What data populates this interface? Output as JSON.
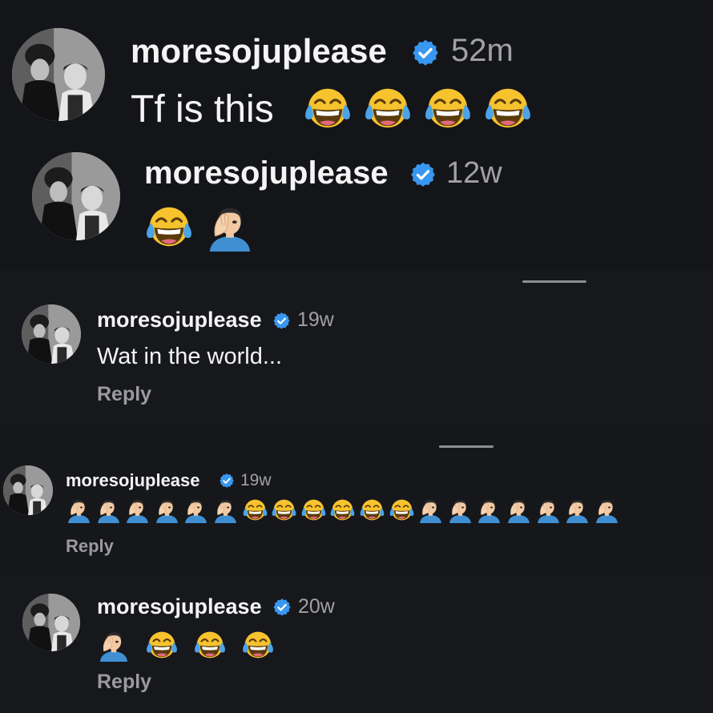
{
  "colors": {
    "background": "#141519",
    "verified_badge": "#3897f0",
    "username": "#f4f4f4",
    "timestamp": "#a0a0a6",
    "reply": "#9a9aa0"
  },
  "comments": [
    {
      "username": "moresojuplease",
      "verified": true,
      "time": "52m",
      "text": "Tf is this",
      "emojis": [
        "joy",
        "joy",
        "joy",
        "joy"
      ],
      "reply_label": ""
    },
    {
      "username": "moresojuplease",
      "verified": true,
      "time": "12w",
      "text": "",
      "emojis": [
        "joy",
        "facepalm"
      ],
      "reply_label": ""
    },
    {
      "username": "moresojuplease",
      "verified": true,
      "time": "19w",
      "text": "Wat in the world...",
      "emojis": [],
      "reply_label": "Reply"
    },
    {
      "username": "moresojuplease",
      "verified": true,
      "time": "19w",
      "text": "",
      "emojis": [
        "facepalm",
        "facepalm",
        "facepalm",
        "facepalm",
        "facepalm",
        "facepalm",
        "joy",
        "joy",
        "joy",
        "joy",
        "joy",
        "joy",
        "facepalm",
        "facepalm",
        "facepalm",
        "facepalm",
        "facepalm",
        "facepalm",
        "facepalm"
      ],
      "reply_label": "Reply"
    },
    {
      "username": "moresojuplease",
      "verified": true,
      "time": "20w",
      "text": "",
      "emojis": [
        "facepalm",
        "joy",
        "joy",
        "joy"
      ],
      "reply_label": "Reply"
    }
  ]
}
